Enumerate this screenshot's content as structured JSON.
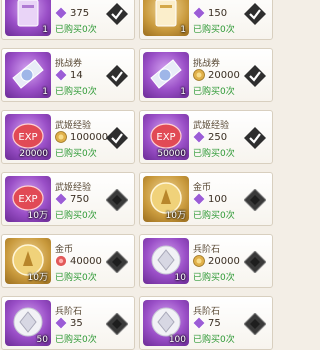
{
  "shop_items": [
    {
      "title": "",
      "icon": "purple-ticket-icon",
      "icon_count": "1",
      "price_icon": "purple-gem-icon",
      "price": "375",
      "bought": "已购买0次",
      "status": "purchased-check-icon"
    },
    {
      "title": "",
      "icon": "gold-ticket-icon",
      "icon_count": "1",
      "price_icon": "purple-gem-icon",
      "price": "150",
      "bought": "已购买0次",
      "status": "purchased-check-icon"
    },
    {
      "title": "挑战券",
      "icon": "challenge-ticket-icon",
      "icon_count": "1",
      "price_icon": "purple-gem-icon",
      "price": "14",
      "bought": "已购买0次",
      "status": "purchased-check-icon"
    },
    {
      "title": "挑战券",
      "icon": "challenge-ticket-icon",
      "icon_count": "1",
      "price_icon": "gold-coin-icon",
      "price": "20000",
      "bought": "已购买0次",
      "status": "purchased-check-icon"
    },
    {
      "title": "武姬经验",
      "icon": "exp-orb-icon",
      "icon_count": "20000",
      "price_icon": "gold-coin-icon",
      "price": "100000",
      "bought": "已购买0次",
      "status": "purchased-check-icon"
    },
    {
      "title": "武姬经验",
      "icon": "exp-orb-icon",
      "icon_count": "50000",
      "price_icon": "purple-gem-icon",
      "price": "250",
      "bought": "已购买0次",
      "status": "purchased-check-icon"
    },
    {
      "title": "武姬经验",
      "icon": "exp-orb-icon",
      "icon_count": "10万",
      "price_icon": "purple-gem-icon",
      "price": "750",
      "bought": "已购买0次",
      "status": "locked-diamond-icon"
    },
    {
      "title": "金币",
      "icon": "gold-coin-icon",
      "icon_count": "10万",
      "price_icon": "purple-gem-icon",
      "price": "100",
      "bought": "已购买0次",
      "status": "locked-diamond-icon"
    },
    {
      "title": "金币",
      "icon": "gold-coin-icon",
      "icon_count": "10万",
      "price_icon": "red-gem-icon",
      "price": "40000",
      "bought": "已购买0次",
      "status": "locked-diamond-icon"
    },
    {
      "title": "兵阶石",
      "icon": "rank-stone-icon",
      "icon_count": "10",
      "price_icon": "gold-coin-icon",
      "price": "20000",
      "bought": "已购买0次",
      "status": "locked-diamond-icon"
    },
    {
      "title": "兵阶石",
      "icon": "rank-stone-icon",
      "icon_count": "50",
      "price_icon": "purple-gem-icon",
      "price": "35",
      "bought": "已购买0次",
      "status": "locked-diamond-icon"
    },
    {
      "title": "兵阶石",
      "icon": "rank-stone-icon",
      "icon_count": "100",
      "price_icon": "purple-gem-icon",
      "price": "75",
      "bought": "已购买0次",
      "status": "locked-diamond-icon"
    }
  ],
  "colors": {
    "bought_text": "#2f9a36",
    "check_bg": "#2e2e2e",
    "diamond_bg": "#3a3a3a"
  }
}
